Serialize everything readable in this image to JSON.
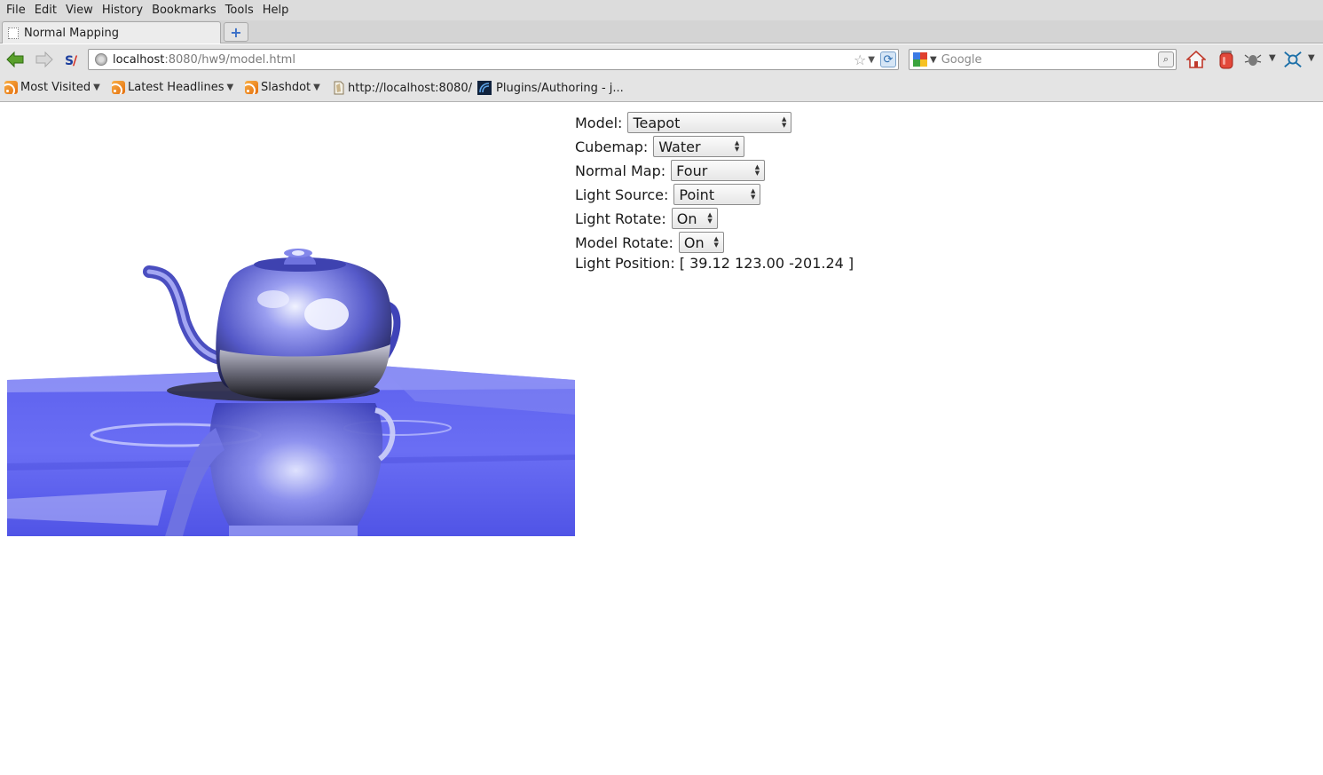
{
  "menubar": {
    "items": [
      "File",
      "Edit",
      "View",
      "History",
      "Bookmarks",
      "Tools",
      "Help"
    ]
  },
  "tabs": [
    {
      "title": "Normal Mapping",
      "active": true
    }
  ],
  "newtab": {
    "icon": "plus-icon"
  },
  "navbar": {
    "back_icon": "back-arrow-icon",
    "forward_icon": "forward-arrow-icon",
    "addon_icon": "stumbleupon-icon",
    "url_host": "localhost",
    "url_rest": ":8080/hw9/model.html",
    "search_placeholder": "Google",
    "home_icon": "home-icon"
  },
  "bookmarks": {
    "items": [
      {
        "label": "Most Visited",
        "icon": "rss-folder-icon",
        "has_dropdown": true
      },
      {
        "label": "Latest Headlines",
        "icon": "rss-icon",
        "has_dropdown": true
      },
      {
        "label": "Slashdot",
        "icon": "rss-icon",
        "has_dropdown": true
      },
      {
        "label": "http://localhost:8080/",
        "icon": "page-icon",
        "has_dropdown": false
      },
      {
        "label": "Plugins/Authoring - j...",
        "icon": "site-icon",
        "has_dropdown": false
      }
    ]
  },
  "controls": {
    "model": {
      "label": "Model:",
      "value": "Teapot"
    },
    "cubemap": {
      "label": "Cubemap:",
      "value": "Water"
    },
    "normal_map": {
      "label": "Normal Map:",
      "value": "Four"
    },
    "light_source": {
      "label": "Light Source:",
      "value": "Point"
    },
    "light_rotate": {
      "label": "Light Rotate:",
      "value": "On"
    },
    "model_rotate": {
      "label": "Model Rotate:",
      "value": "On"
    },
    "light_position": "Light Position: [ 39.12 123.00 -201.24 ]"
  },
  "scene": {
    "description_colors": {
      "floor": "#5a5ef0",
      "teapot": "#5c60d8",
      "highlight": "#e8ecff"
    }
  }
}
